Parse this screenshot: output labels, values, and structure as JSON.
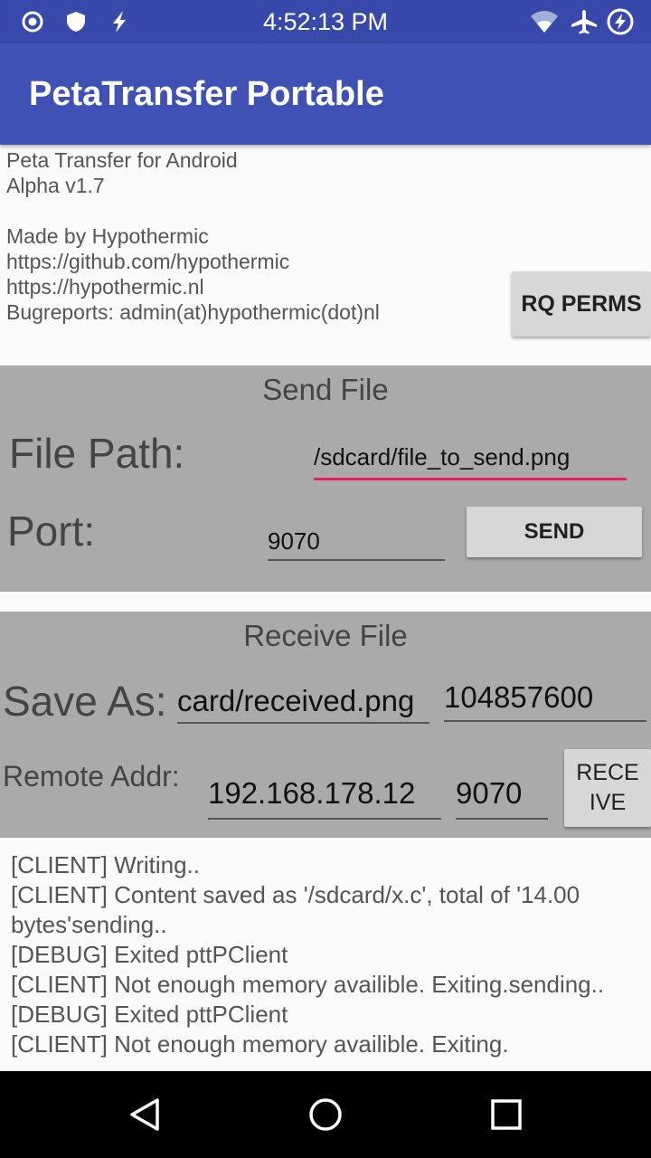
{
  "status_bar": {
    "time": "4:52:13 PM",
    "left_icons": [
      "target-icon",
      "shield-icon",
      "flash-icon"
    ],
    "right_icons": [
      "wifi-icon",
      "airplane-icon",
      "data-saver-icon"
    ]
  },
  "app_bar": {
    "title": "PetaTransfer Portable"
  },
  "info": {
    "lines": [
      "Peta Transfer for Android",
      "Alpha v1.7",
      "",
      "Made by Hypothermic",
      "https://github.com/hypothermic",
      "https://hypothermic.nl",
      "Bugreports: admin(at)hypothermic(dot)nl"
    ],
    "rq_perms_label": "RQ PERMS"
  },
  "send": {
    "title": "Send File",
    "file_path_label": "File Path:",
    "file_path_value": "/sdcard/file_to_send.png",
    "port_label": "Port:",
    "port_value": "9070",
    "send_label": "SEND"
  },
  "receive": {
    "title": "Receive File",
    "save_as_label": "Save As:",
    "save_as_value": "card/received.png",
    "size_value": "104857600",
    "remote_addr_label": "Remote Addr:",
    "remote_addr_value": "192.168.178.12",
    "port_value": "9070",
    "receive_label_line1": "RECE",
    "receive_label_line2": "IVE"
  },
  "log": {
    "lines": [
      "[CLIENT] Writing..",
      "[CLIENT] Content saved as '/sdcard/x.c', total of '14.00",
      "bytes'sending..",
      "[DEBUG] Exited pttPClient",
      "[CLIENT] Not enough memory availible. Exiting.sending..",
      "[DEBUG] Exited pttPClient",
      "[CLIENT] Not enough memory availible. Exiting."
    ]
  },
  "nav_bar": {
    "icons": [
      "back-icon",
      "home-icon",
      "recents-icon"
    ]
  },
  "colors": {
    "status_bar": "#3949ab",
    "app_bar": "#3f51b5",
    "panel": "#aaaaaa",
    "accent_underline": "#e91e63"
  }
}
